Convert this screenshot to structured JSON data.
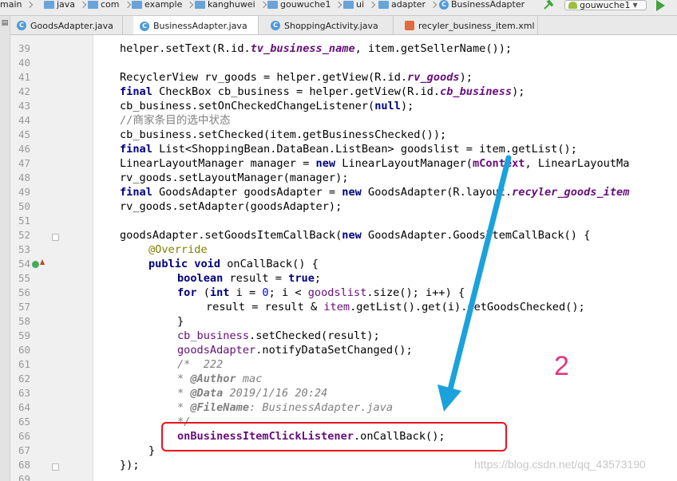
{
  "breadcrumb": {
    "items": [
      {
        "label": "main",
        "icon": "folder-icon"
      },
      {
        "label": "java",
        "icon": "folder-icon"
      },
      {
        "label": "com",
        "icon": "folder-icon"
      },
      {
        "label": "example",
        "icon": "folder-icon"
      },
      {
        "label": "kanghuwei",
        "icon": "folder-icon"
      },
      {
        "label": "gouwuche1",
        "icon": "folder-icon"
      },
      {
        "label": "ui",
        "icon": "folder-icon"
      },
      {
        "label": "adapter",
        "icon": "folder-icon"
      },
      {
        "label": "BusinessAdapter",
        "icon": "class-icon"
      }
    ]
  },
  "toolbar": {
    "run_config": "gouwuche1"
  },
  "tabs": [
    {
      "label": "GoodsAdapter.java",
      "icon": "class-icon",
      "active": false
    },
    {
      "label": "BusinessAdapter.java",
      "icon": "class-icon",
      "active": true
    },
    {
      "label": "ShoppingActivity.java",
      "icon": "class-icon",
      "active": false
    },
    {
      "label": "recyler_business_item.xml",
      "icon": "xml-icon",
      "active": false
    }
  ],
  "editor": {
    "line_numbers": [
      "39",
      "40",
      "41",
      "42",
      "43",
      "44",
      "45",
      "46",
      "47",
      "48",
      "49",
      "50",
      "51",
      "52",
      "53",
      "54",
      "55",
      "56",
      "57",
      "58",
      "59",
      "60",
      "61",
      "62",
      "63",
      "64",
      "65",
      "66",
      "67",
      "68",
      "69"
    ],
    "code": {
      "l39": [
        "helper.setText(R.id.",
        "tv_business_name",
        ", item.getSellerName());"
      ],
      "l41": [
        "RecyclerView rv_goods = helper.getView(R.id.",
        "rv_goods",
        ");"
      ],
      "l42": [
        "final",
        " CheckBox cb_business = helper.getView(R.id.",
        "cb_business",
        ");"
      ],
      "l43": [
        "cb_business.setOnCheckedChangeListener(",
        "null",
        ");"
      ],
      "l44": [
        "//商家条目的选中状态"
      ],
      "l45": [
        "cb_business.setChecked(item.getBusinessChecked());"
      ],
      "l46": [
        "final",
        " List<ShoppingBean.DataBean.ListBean> goodslist = item.getList();"
      ],
      "l47": [
        "LinearLayoutManager manager = ",
        "new",
        " LinearLayoutManager(",
        "mContext",
        ", LinearLayoutMa"
      ],
      "l48": [
        "rv_goods.setLayoutManager(manager);"
      ],
      "l49": [
        "final",
        " GoodsAdapter goodsAdapter = ",
        "new",
        " GoodsAdapter(R.layout.",
        "recyler_goods_item"
      ],
      "l50": [
        "rv_goods.setAdapter(goodsAdapter);"
      ],
      "l52": [
        "goodsAdapter.setGoodsItemCallBack(",
        "new",
        " GoodsAdapter.GoodsItemCallBack() {"
      ],
      "l53": [
        "@Override"
      ],
      "l54": [
        "public",
        " ",
        "void",
        " onCallBack() {"
      ],
      "l55": [
        "boolean",
        " result = ",
        "true",
        ";"
      ],
      "l56": [
        "for",
        " (",
        "int",
        " i = ",
        "0",
        "; i < ",
        "goodslist",
        ".size(); i++) {"
      ],
      "l57": [
        "result = result & ",
        "item",
        ".getList().get(i).getGoodsChecked();"
      ],
      "l58": [
        "}"
      ],
      "l59": [
        "cb_business",
        ".setChecked(result);"
      ],
      "l60": [
        "goodsAdapter",
        ".notifyDataSetChanged();"
      ],
      "l61": [
        "/*  222"
      ],
      "l62": [
        "* ",
        "@Author",
        " mac"
      ],
      "l63": [
        "* ",
        "@Data",
        " 2019/1/16 20:24"
      ],
      "l64": [
        "* ",
        "@FileName",
        ": BusinessAdapter.java"
      ],
      "l65": [
        "*/"
      ],
      "l66": [
        "onBusinessItemClickListener",
        ".onCallBack();"
      ],
      "l67": [
        "}"
      ],
      "l68": [
        "});"
      ]
    }
  },
  "annotation": {
    "step_number": "2",
    "arrow_color": "#1ba2dc",
    "box_color": "#e8131c"
  },
  "watermark": "https://blog.csdn.net/qq_43573190"
}
